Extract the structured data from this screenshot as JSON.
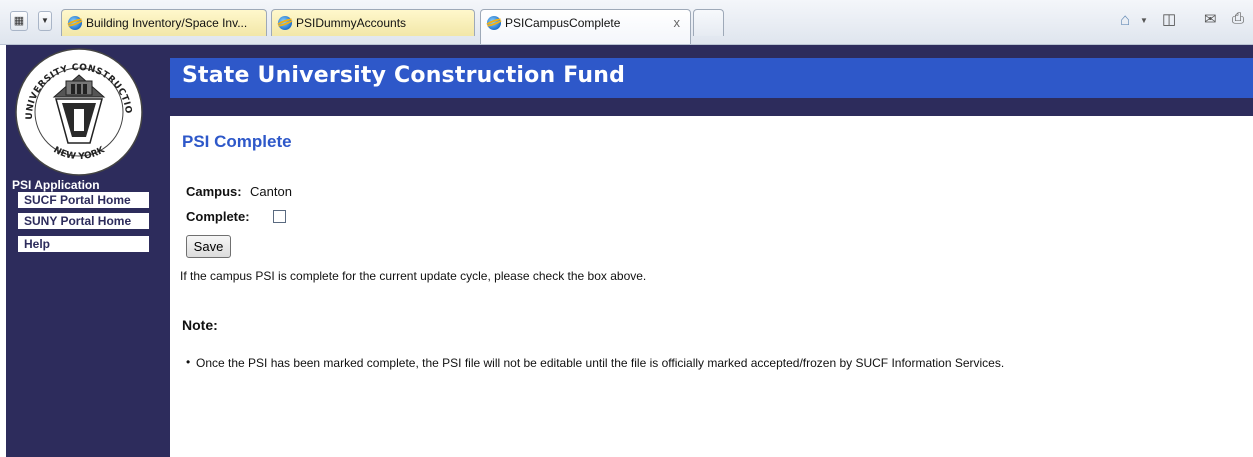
{
  "browser": {
    "tabs": [
      {
        "label": "Building Inventory/Space Inv..."
      },
      {
        "label": "PSIDummyAccounts"
      },
      {
        "label": "PSICampusComplete",
        "active": true
      }
    ],
    "close_symbol": "x",
    "icons": [
      "quick-tabs-icon",
      "tab-list-dropdown-icon",
      "home-icon",
      "feeds-icon",
      "mail-icon",
      "print-icon"
    ]
  },
  "site": {
    "title": "State University Construction Fund",
    "seal": {
      "top_text": "STATE UNIVERSITY CONSTRUCTION FUND",
      "bottom_text": "NEW YORK"
    },
    "colors": {
      "navy": "#2d2c5c",
      "banner_blue": "#2e58c9"
    }
  },
  "sidebar": {
    "section_label": "PSI Application",
    "items": [
      {
        "label": "SUCF Portal Home"
      },
      {
        "label": "SUNY Portal Home"
      },
      {
        "label": "Help"
      }
    ]
  },
  "main": {
    "title": "PSI Complete",
    "campus_label": "Campus:",
    "campus_value": "Canton",
    "complete_label": "Complete:",
    "complete_checked": false,
    "save_label": "Save",
    "instruction": "If the campus PSI is complete for the current update cycle, please check the box above.",
    "note_label": "Note:",
    "notes": [
      "Once the PSI has been marked complete, the PSI file will not be editable until the file is officially marked accepted/frozen by SUCF Information Services."
    ]
  }
}
